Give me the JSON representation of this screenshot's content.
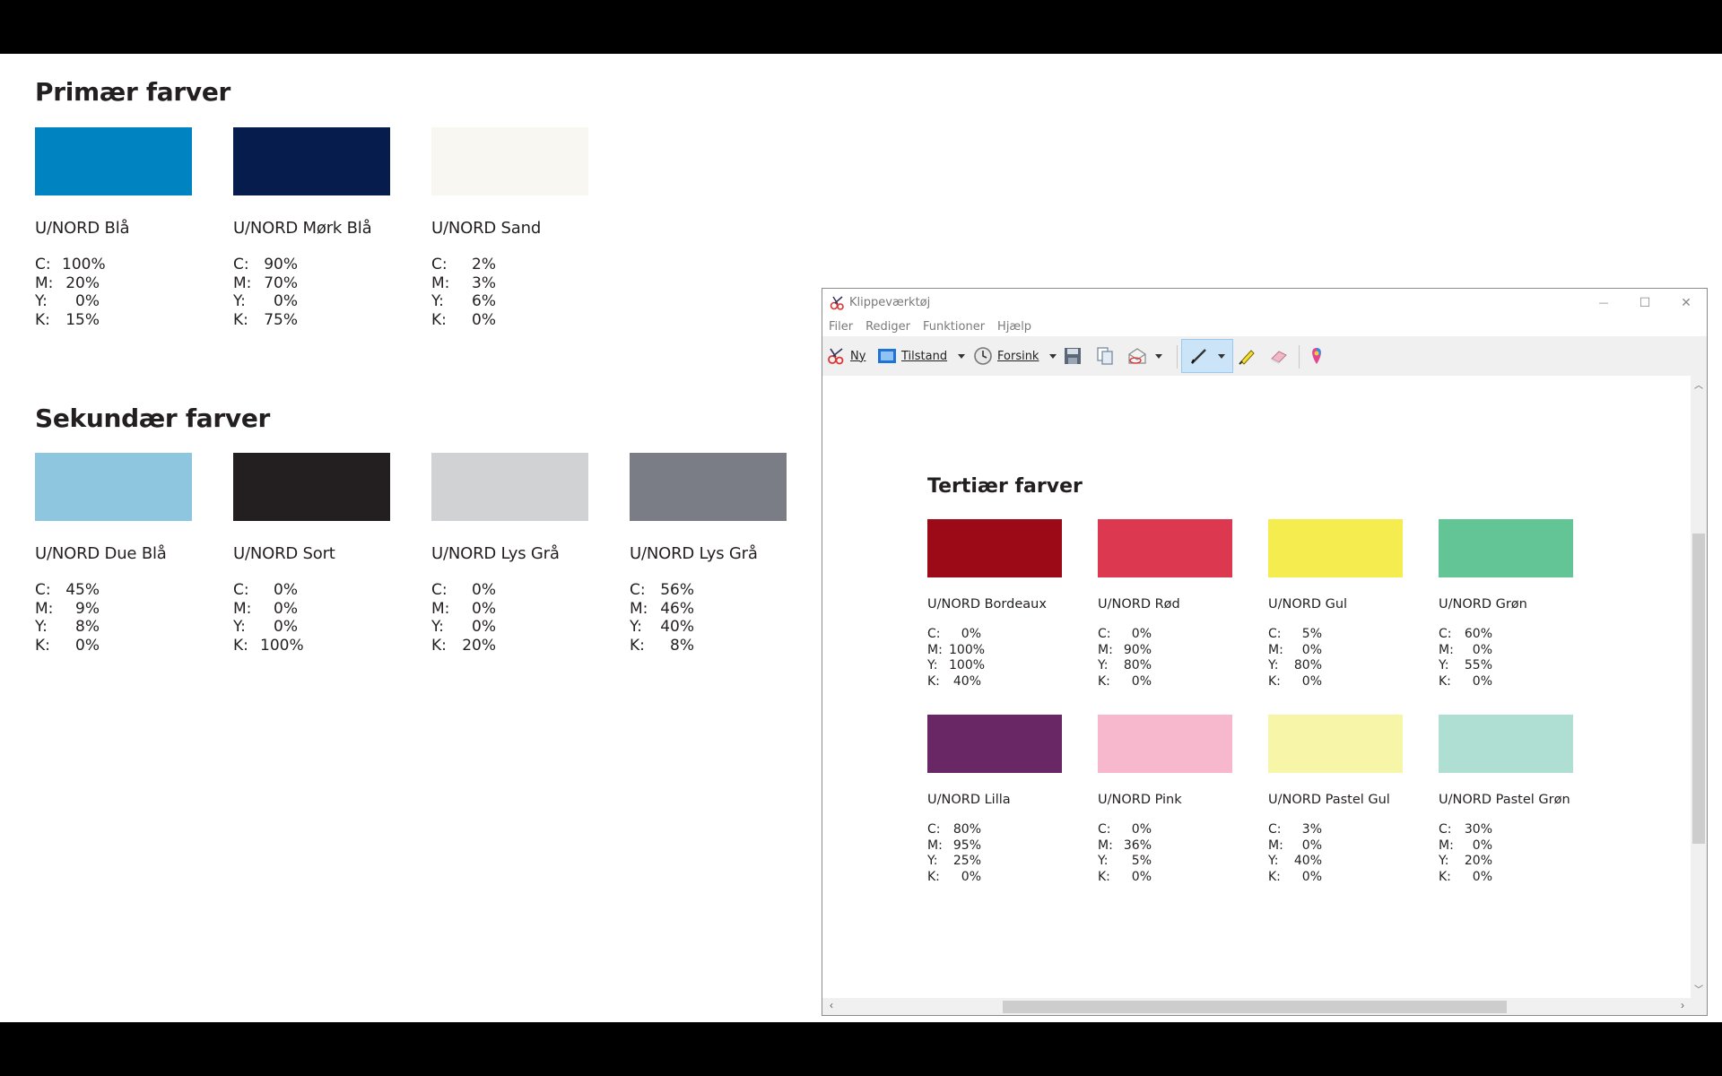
{
  "document": {
    "primary": {
      "heading": "Primær farver",
      "cards": [
        {
          "name": "U/NORD Blå",
          "color": "#0083c1",
          "c": "100%",
          "m": "20%",
          "y": "0%",
          "k": "15%"
        },
        {
          "name": "U/NORD Mørk Blå",
          "color": "#051c4c",
          "c": "90%",
          "m": "70%",
          "y": "0%",
          "k": "75%"
        },
        {
          "name": "U/NORD Sand",
          "color": "#f9f7f1",
          "c": "2%",
          "m": "3%",
          "y": "6%",
          "k": "0%"
        }
      ]
    },
    "secondary": {
      "heading": "Sekundær farver",
      "cards": [
        {
          "name": "U/NORD Due Blå",
          "color": "#8ec5df",
          "c": "45%",
          "m": "9%",
          "y": "8%",
          "k": "0%"
        },
        {
          "name": "U/NORD Sort",
          "color": "#231f20",
          "c": "0%",
          "m": "0%",
          "y": "0%",
          "k": "100%"
        },
        {
          "name": "U/NORD Lys Grå",
          "color": "#d1d2d4",
          "c": "0%",
          "m": "0%",
          "y": "0%",
          "k": "20%"
        },
        {
          "name": "U/NORD Lys Grå",
          "color": "#7a7d85",
          "c": "56%",
          "m": "46%",
          "y": "40%",
          "k": "8%"
        }
      ]
    }
  },
  "window": {
    "title": "Klippeværktøj",
    "controls": {
      "minimize": "—",
      "maximize": "☐",
      "close": "✕"
    },
    "menu": [
      "Filer",
      "Rediger",
      "Funktioner",
      "Hjælp"
    ],
    "toolbar": {
      "new": "Ny",
      "mode": "Tilstand",
      "delay": "Forsink"
    },
    "content": {
      "heading": "Tertiær farver",
      "cards": [
        {
          "name": "U/NORD Bordeaux",
          "color": "#9b0a16",
          "c": "0%",
          "m": "100%",
          "y": "100%",
          "k": "40%"
        },
        {
          "name": "U/NORD Rød",
          "color": "#dc3950",
          "c": "0%",
          "m": "90%",
          "y": "80%",
          "k": "0%"
        },
        {
          "name": "U/NORD Gul",
          "color": "#f5ed4f",
          "c": "5%",
          "m": "0%",
          "y": "80%",
          "k": "0%"
        },
        {
          "name": "U/NORD Grøn",
          "color": "#63c495",
          "c": "60%",
          "m": "0%",
          "y": "55%",
          "k": "0%"
        },
        {
          "name": "U/NORD Lilla",
          "color": "#6a2765",
          "c": "80%",
          "m": "95%",
          "y": "25%",
          "k": "0%"
        },
        {
          "name": "U/NORD Pink",
          "color": "#f7b8cd",
          "c": "0%",
          "m": "36%",
          "y": "5%",
          "k": "0%"
        },
        {
          "name": "U/NORD Pastel Gul",
          "color": "#f7f6a8",
          "c": "3%",
          "m": "0%",
          "y": "40%",
          "k": "0%"
        },
        {
          "name": "U/NORD Pastel Grøn",
          "color": "#afdfd2",
          "c": "30%",
          "m": "0%",
          "y": "20%",
          "k": "0%"
        }
      ]
    }
  },
  "labels": {
    "c": "C:",
    "m": "M:",
    "y": "Y:",
    "k": "K:"
  }
}
